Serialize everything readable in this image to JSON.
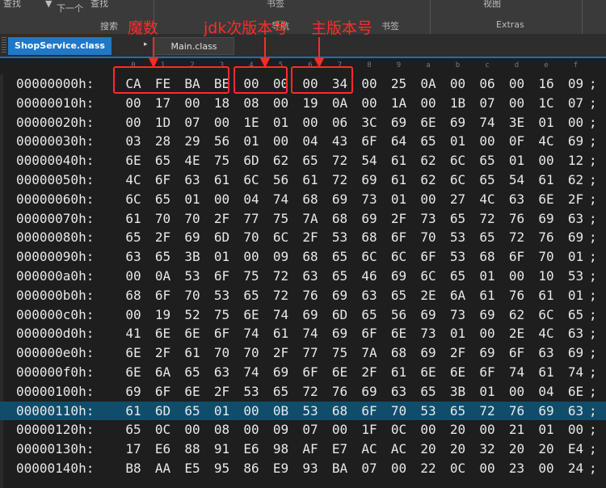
{
  "toolbar": {
    "group_labels": [
      "搜索",
      "导航",
      "书签",
      "Extras"
    ],
    "top_fragments": [
      "查找",
      "下一个",
      "查找",
      "书签",
      "视图"
    ]
  },
  "tabs": [
    {
      "label": "ShopService.class",
      "active": true
    },
    {
      "label": "Main.class",
      "active": false
    }
  ],
  "column_header": [
    "0",
    "1",
    "2",
    "3",
    "4",
    "5",
    "6",
    "7",
    "8",
    "9",
    "a",
    "b",
    "c",
    "d",
    "e",
    "f"
  ],
  "annotations": {
    "magic": "魔数",
    "minor": "jdk次版本号",
    "major": "主版本号"
  },
  "rows": [
    {
      "addr": "00000000h:",
      "bytes": [
        "CA",
        "FE",
        "BA",
        "BE",
        "00",
        "00",
        "00",
        "34",
        "00",
        "25",
        "0A",
        "00",
        "06",
        "00",
        "16",
        "09"
      ]
    },
    {
      "addr": "00000010h:",
      "bytes": [
        "00",
        "17",
        "00",
        "18",
        "08",
        "00",
        "19",
        "0A",
        "00",
        "1A",
        "00",
        "1B",
        "07",
        "00",
        "1C",
        "07"
      ]
    },
    {
      "addr": "00000020h:",
      "bytes": [
        "00",
        "1D",
        "07",
        "00",
        "1E",
        "01",
        "00",
        "06",
        "3C",
        "69",
        "6E",
        "69",
        "74",
        "3E",
        "01",
        "00"
      ]
    },
    {
      "addr": "00000030h:",
      "bytes": [
        "03",
        "28",
        "29",
        "56",
        "01",
        "00",
        "04",
        "43",
        "6F",
        "64",
        "65",
        "01",
        "00",
        "0F",
        "4C",
        "69"
      ]
    },
    {
      "addr": "00000040h:",
      "bytes": [
        "6E",
        "65",
        "4E",
        "75",
        "6D",
        "62",
        "65",
        "72",
        "54",
        "61",
        "62",
        "6C",
        "65",
        "01",
        "00",
        "12"
      ]
    },
    {
      "addr": "00000050h:",
      "bytes": [
        "4C",
        "6F",
        "63",
        "61",
        "6C",
        "56",
        "61",
        "72",
        "69",
        "61",
        "62",
        "6C",
        "65",
        "54",
        "61",
        "62"
      ]
    },
    {
      "addr": "00000060h:",
      "bytes": [
        "6C",
        "65",
        "01",
        "00",
        "04",
        "74",
        "68",
        "69",
        "73",
        "01",
        "00",
        "27",
        "4C",
        "63",
        "6E",
        "2F"
      ]
    },
    {
      "addr": "00000070h:",
      "bytes": [
        "61",
        "70",
        "70",
        "2F",
        "77",
        "75",
        "7A",
        "68",
        "69",
        "2F",
        "73",
        "65",
        "72",
        "76",
        "69",
        "63"
      ]
    },
    {
      "addr": "00000080h:",
      "bytes": [
        "65",
        "2F",
        "69",
        "6D",
        "70",
        "6C",
        "2F",
        "53",
        "68",
        "6F",
        "70",
        "53",
        "65",
        "72",
        "76",
        "69"
      ]
    },
    {
      "addr": "00000090h:",
      "bytes": [
        "63",
        "65",
        "3B",
        "01",
        "00",
        "09",
        "68",
        "65",
        "6C",
        "6C",
        "6F",
        "53",
        "68",
        "6F",
        "70",
        "01"
      ]
    },
    {
      "addr": "000000a0h:",
      "bytes": [
        "00",
        "0A",
        "53",
        "6F",
        "75",
        "72",
        "63",
        "65",
        "46",
        "69",
        "6C",
        "65",
        "01",
        "00",
        "10",
        "53"
      ]
    },
    {
      "addr": "000000b0h:",
      "bytes": [
        "68",
        "6F",
        "70",
        "53",
        "65",
        "72",
        "76",
        "69",
        "63",
        "65",
        "2E",
        "6A",
        "61",
        "76",
        "61",
        "01"
      ]
    },
    {
      "addr": "000000c0h:",
      "bytes": [
        "00",
        "19",
        "52",
        "75",
        "6E",
        "74",
        "69",
        "6D",
        "65",
        "56",
        "69",
        "73",
        "69",
        "62",
        "6C",
        "65"
      ]
    },
    {
      "addr": "000000d0h:",
      "bytes": [
        "41",
        "6E",
        "6E",
        "6F",
        "74",
        "61",
        "74",
        "69",
        "6F",
        "6E",
        "73",
        "01",
        "00",
        "2E",
        "4C",
        "63"
      ]
    },
    {
      "addr": "000000e0h:",
      "bytes": [
        "6E",
        "2F",
        "61",
        "70",
        "70",
        "2F",
        "77",
        "75",
        "7A",
        "68",
        "69",
        "2F",
        "69",
        "6F",
        "63",
        "69"
      ]
    },
    {
      "addr": "000000f0h:",
      "bytes": [
        "6E",
        "6A",
        "65",
        "63",
        "74",
        "69",
        "6F",
        "6E",
        "2F",
        "61",
        "6E",
        "6E",
        "6F",
        "74",
        "61",
        "74"
      ]
    },
    {
      "addr": "00000100h:",
      "bytes": [
        "69",
        "6F",
        "6E",
        "2F",
        "53",
        "65",
        "72",
        "76",
        "69",
        "63",
        "65",
        "3B",
        "01",
        "00",
        "04",
        "6E"
      ]
    },
    {
      "addr": "00000110h:",
      "bytes": [
        "61",
        "6D",
        "65",
        "01",
        "00",
        "0B",
        "53",
        "68",
        "6F",
        "70",
        "53",
        "65",
        "72",
        "76",
        "69",
        "63"
      ],
      "selected": true
    },
    {
      "addr": "00000120h:",
      "bytes": [
        "65",
        "0C",
        "00",
        "08",
        "00",
        "09",
        "07",
        "00",
        "1F",
        "0C",
        "00",
        "20",
        "00",
        "21",
        "01",
        "00"
      ]
    },
    {
      "addr": "00000130h:",
      "bytes": [
        "17",
        "E6",
        "88",
        "91",
        "E6",
        "98",
        "AF",
        "E7",
        "AC",
        "AC",
        "20",
        "20",
        "32",
        "20",
        "20",
        "E4"
      ]
    },
    {
      "addr": "00000140h:",
      "bytes": [
        "B8",
        "AA",
        "E5",
        "95",
        "86",
        "E9",
        "93",
        "BA",
        "07",
        "00",
        "22",
        "0C",
        "00",
        "23",
        "00",
        "24"
      ]
    }
  ],
  "row_terminator": ";",
  "colors": {
    "annotation": "#ff2a2a",
    "selected_row": "#0f4d6b",
    "active_tab": "#1f78c8"
  }
}
